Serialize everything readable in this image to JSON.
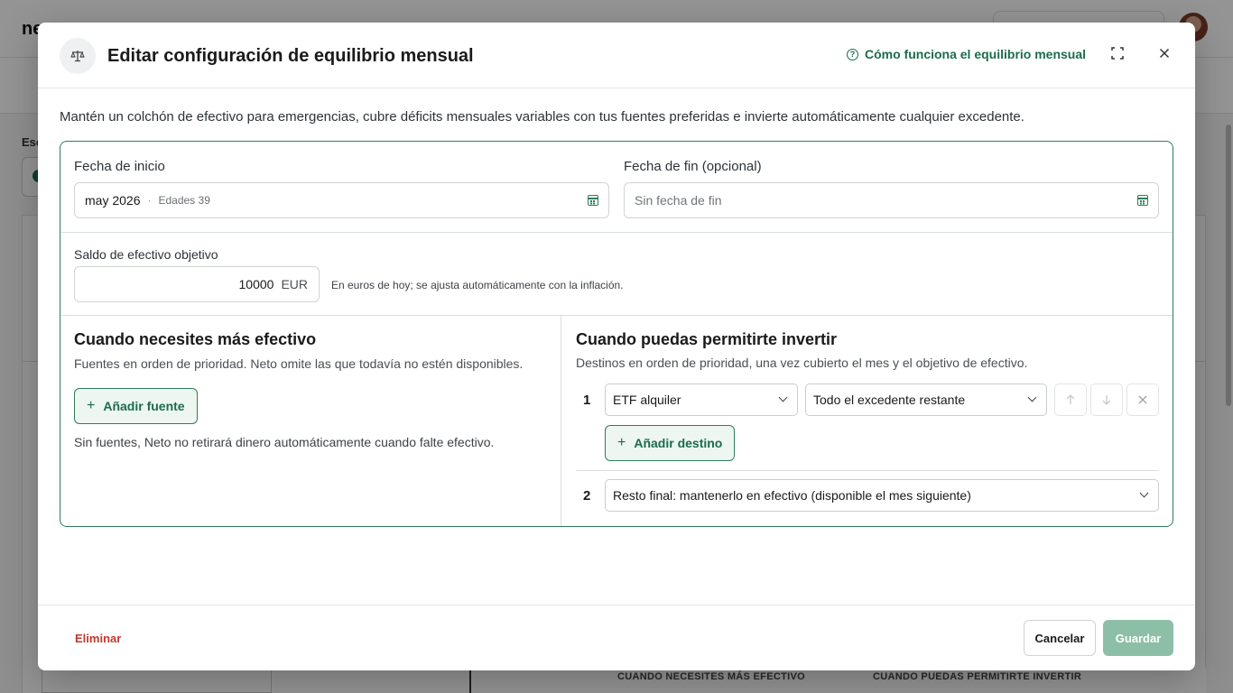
{
  "background": {
    "logo": "ne",
    "section_prefix": "Esc",
    "table_headers": [
      "CUANDO NECESITES MÁS EFECTIVO",
      "CUANDO PUEDAS PERMITIRTE INVERTIR"
    ]
  },
  "modal": {
    "title": "Editar configuración de equilibrio mensual",
    "title_icon": "balance-scale-icon",
    "help_link": "Cómo funciona el equilibrio mensual",
    "intro": "Mantén un colchón de efectivo para emergencias, cubre déficits mensuales variables con tus fuentes preferidas e invierte automáticamente cualquier excedente.",
    "dates": {
      "start_label": "Fecha de inicio",
      "start_value": "may 2026",
      "start_separator": "·",
      "start_age": "Edades 39",
      "end_label": "Fecha de fin (opcional)",
      "end_placeholder": "Sin fecha de fin"
    },
    "cash": {
      "label": "Saldo de efectivo objetivo",
      "value": "10000",
      "unit": "EUR",
      "help": "En euros de hoy; se ajusta automáticamente con la inflación."
    },
    "sources": {
      "title": "Cuando necesites más efectivo",
      "subtitle": "Fuentes en orden de prioridad. Neto omite las que todavía no estén disponibles.",
      "add_label": "Añadir fuente",
      "empty_note": "Sin fuentes, Neto no retirará dinero automáticamente cuando falte efectivo."
    },
    "destinations": {
      "title": "Cuando puedas permitirte invertir",
      "subtitle": "Destinos en orden de prioridad, una vez cubierto el mes y el objetivo de efectivo.",
      "rows": [
        {
          "num": "1",
          "asset": "ETF alquiler",
          "amount": "Todo el excedente restante"
        },
        {
          "num": "2",
          "final": "Resto final: mantenerlo en efectivo (disponible el mes siguiente)"
        }
      ],
      "add_label": "Añadir destino"
    },
    "footer": {
      "delete": "Eliminar",
      "cancel": "Cancelar",
      "save": "Guardar"
    }
  },
  "colors": {
    "accent": "#1c6b4d",
    "border_accent": "#2e7d5b",
    "danger": "#c0392b",
    "save_disabled": "#8dbfa7"
  }
}
